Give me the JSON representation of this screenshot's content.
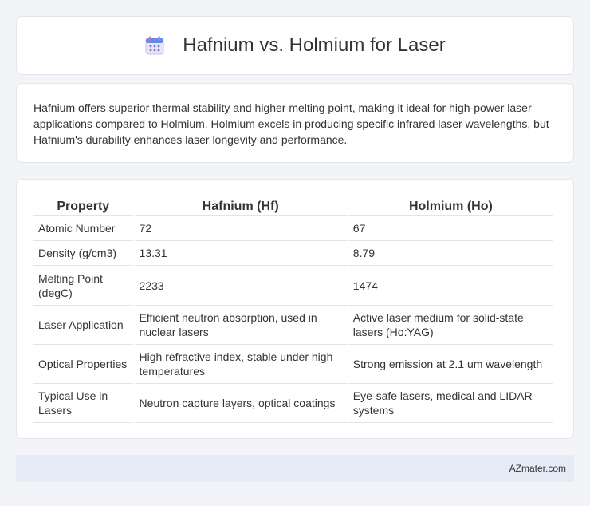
{
  "header": {
    "title": "Hafnium vs. Holmium for Laser",
    "icon": "calendar-icon"
  },
  "intro": {
    "text": "Hafnium offers superior thermal stability and higher melting point, making it ideal for high-power laser applications compared to Holmium. Holmium excels in producing specific infrared laser wavelengths, but Hafnium's durability enhances laser longevity and performance."
  },
  "table": {
    "headers": [
      "Property",
      "Hafnium (Hf)",
      "Holmium (Ho)"
    ],
    "rows": [
      [
        "Atomic Number",
        "72",
        "67"
      ],
      [
        "Density (g/cm3)",
        "13.31",
        "8.79"
      ],
      [
        "Melting Point (degC)",
        "2233",
        "1474"
      ],
      [
        "Laser Application",
        "Efficient neutron absorption, used in nuclear lasers",
        "Active laser medium for solid-state lasers (Ho:YAG)"
      ],
      [
        "Optical Properties",
        "High refractive index, stable under high temperatures",
        "Strong emission at 2.1 um wavelength"
      ],
      [
        "Typical Use in Lasers",
        "Neutron capture layers, optical coatings",
        "Eye-safe lasers, medical and LIDAR systems"
      ]
    ]
  },
  "footer": {
    "text": "AZmater.com"
  }
}
